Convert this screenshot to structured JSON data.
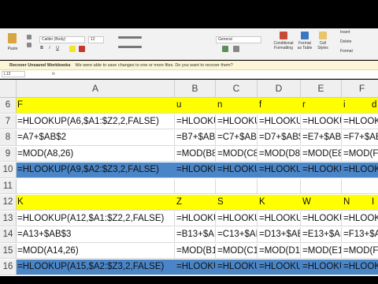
{
  "ribbon": {
    "paste_label": "Paste",
    "font_name": "Calibri (Body)",
    "font_size": "12",
    "number_format": "General",
    "conditional_formatting": "Conditional Formatting",
    "format_as_table": "Format as Table",
    "cell_styles": "Cell Styles",
    "insert_label": "Insert",
    "delete_label": "Delete",
    "format_label": "Format"
  },
  "notice": {
    "title": "Recover Unsaved Workbooks",
    "message": "We were able to save changes to one or more files. Do you want to recover them?"
  },
  "formula_bar": {
    "name_box": "L13",
    "fx": "fx"
  },
  "columns": [
    "A",
    "B",
    "C",
    "D",
    "E",
    "F"
  ],
  "rows": [
    {
      "num": "6",
      "style": "yellow",
      "cells": [
        "F",
        "u",
        "n",
        "f",
        "r",
        "i",
        "d"
      ]
    },
    {
      "num": "7",
      "style": "",
      "cells": [
        "=HLOOKUP(A6,$A1:$Z2,2,FALSE)",
        "=HLOOKUI",
        "=HLOOKUI",
        "=HLOOKUI",
        "=HLOOKUI",
        "=HLOOKUI"
      ]
    },
    {
      "num": "8",
      "style": "",
      "cells": [
        "=A7+$AB$2",
        "=B7+$AB$",
        "=C7+$AB$",
        "=D7+$AB$",
        "=E7+$AB$",
        "=F7+$AB$"
      ]
    },
    {
      "num": "9",
      "style": "",
      "cells": [
        "=MOD(A8,26)",
        "=MOD(B8,",
        "=MOD(C8,",
        "=MOD(D8,",
        "=MOD(E8,",
        "=MOD(F8,"
      ]
    },
    {
      "num": "10",
      "style": "blue",
      "cells": [
        "=HLOOKUP(A9,$A2:$Z3,2,FALSE)",
        "=HLOOKUI",
        "=HLOOKUI",
        "=HLOOKUI",
        "=HLOOKUI",
        "=HLOOKUI"
      ]
    },
    {
      "num": "11",
      "style": "",
      "cells": [
        "",
        "",
        "",
        "",
        "",
        ""
      ]
    },
    {
      "num": "12",
      "style": "yellow",
      "cells": [
        "K",
        "Z",
        "S",
        "K",
        "W",
        "N",
        "I"
      ]
    },
    {
      "num": "13",
      "style": "",
      "cells": [
        "=HLOOKUP(A12,$A1:$Z2,2,FALSE)",
        "=HLOOKUI",
        "=HLOOKUI",
        "=HLOOKUI",
        "=HLOOKUI",
        "=HLOOKUI"
      ]
    },
    {
      "num": "14",
      "style": "",
      "cells": [
        "=A13+$AB$3",
        "=B13+$AB",
        "=C13+$AB",
        "=D13+$AB",
        "=E13+$AB",
        "=F13+$AB"
      ]
    },
    {
      "num": "15",
      "style": "",
      "cells": [
        "=MOD(A14,26)",
        "=MOD(B14",
        "=MOD(C14",
        "=MOD(D14",
        "=MOD(E14",
        "=MOD(F14"
      ]
    },
    {
      "num": "16",
      "style": "blue",
      "cells": [
        "=HLOOKUP(A15,$A2:$Z3,2,FALSE)",
        "=HLOOKUI",
        "=HLOOKUI",
        "=HLOOKUI",
        "=HLOOKUI",
        "=HLOOKUI"
      ]
    },
    {
      "num": "17",
      "style": "",
      "cells": [
        "",
        "",
        "",
        "",
        "",
        ""
      ]
    }
  ]
}
